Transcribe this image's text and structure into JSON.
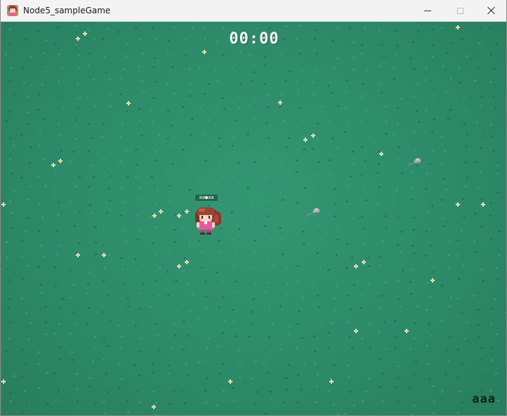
{
  "window": {
    "title": "Node5_sampleGame",
    "minimize_icon": "minimize-icon",
    "maximize_icon": "maximize-icon",
    "close_icon": "close-icon"
  },
  "hud": {
    "timer": "00:00",
    "username": "aaa"
  },
  "player": {
    "name_tag": "aa●aa",
    "sprite": "girl-character-sprite"
  },
  "colors": {
    "field": "#2e8a66",
    "flower": "#f4ead0",
    "rock": "#9aa3a8",
    "hud_text": "#ffffff"
  }
}
